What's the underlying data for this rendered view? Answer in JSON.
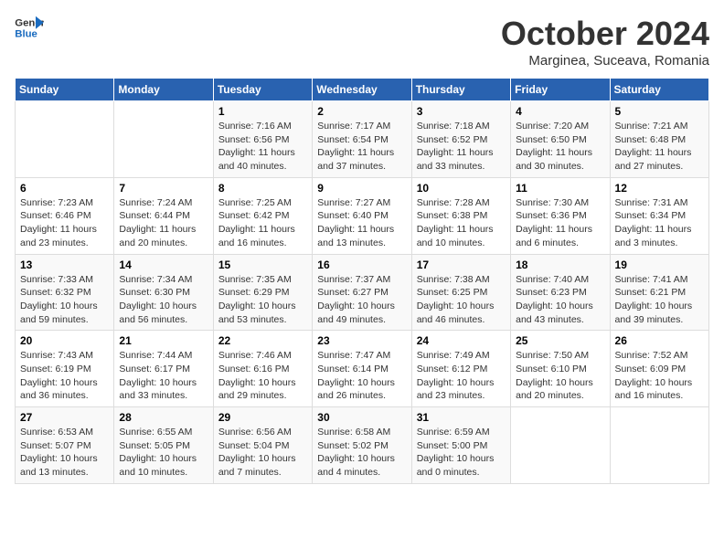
{
  "logo": {
    "line1": "General",
    "line2": "Blue"
  },
  "title": "October 2024",
  "location": "Marginea, Suceava, Romania",
  "days_of_week": [
    "Sunday",
    "Monday",
    "Tuesday",
    "Wednesday",
    "Thursday",
    "Friday",
    "Saturday"
  ],
  "weeks": [
    [
      {
        "day": "",
        "info": ""
      },
      {
        "day": "",
        "info": ""
      },
      {
        "day": "1",
        "info": "Sunrise: 7:16 AM\nSunset: 6:56 PM\nDaylight: 11 hours and 40 minutes."
      },
      {
        "day": "2",
        "info": "Sunrise: 7:17 AM\nSunset: 6:54 PM\nDaylight: 11 hours and 37 minutes."
      },
      {
        "day": "3",
        "info": "Sunrise: 7:18 AM\nSunset: 6:52 PM\nDaylight: 11 hours and 33 minutes."
      },
      {
        "day": "4",
        "info": "Sunrise: 7:20 AM\nSunset: 6:50 PM\nDaylight: 11 hours and 30 minutes."
      },
      {
        "day": "5",
        "info": "Sunrise: 7:21 AM\nSunset: 6:48 PM\nDaylight: 11 hours and 27 minutes."
      }
    ],
    [
      {
        "day": "6",
        "info": "Sunrise: 7:23 AM\nSunset: 6:46 PM\nDaylight: 11 hours and 23 minutes."
      },
      {
        "day": "7",
        "info": "Sunrise: 7:24 AM\nSunset: 6:44 PM\nDaylight: 11 hours and 20 minutes."
      },
      {
        "day": "8",
        "info": "Sunrise: 7:25 AM\nSunset: 6:42 PM\nDaylight: 11 hours and 16 minutes."
      },
      {
        "day": "9",
        "info": "Sunrise: 7:27 AM\nSunset: 6:40 PM\nDaylight: 11 hours and 13 minutes."
      },
      {
        "day": "10",
        "info": "Sunrise: 7:28 AM\nSunset: 6:38 PM\nDaylight: 11 hours and 10 minutes."
      },
      {
        "day": "11",
        "info": "Sunrise: 7:30 AM\nSunset: 6:36 PM\nDaylight: 11 hours and 6 minutes."
      },
      {
        "day": "12",
        "info": "Sunrise: 7:31 AM\nSunset: 6:34 PM\nDaylight: 11 hours and 3 minutes."
      }
    ],
    [
      {
        "day": "13",
        "info": "Sunrise: 7:33 AM\nSunset: 6:32 PM\nDaylight: 10 hours and 59 minutes."
      },
      {
        "day": "14",
        "info": "Sunrise: 7:34 AM\nSunset: 6:30 PM\nDaylight: 10 hours and 56 minutes."
      },
      {
        "day": "15",
        "info": "Sunrise: 7:35 AM\nSunset: 6:29 PM\nDaylight: 10 hours and 53 minutes."
      },
      {
        "day": "16",
        "info": "Sunrise: 7:37 AM\nSunset: 6:27 PM\nDaylight: 10 hours and 49 minutes."
      },
      {
        "day": "17",
        "info": "Sunrise: 7:38 AM\nSunset: 6:25 PM\nDaylight: 10 hours and 46 minutes."
      },
      {
        "day": "18",
        "info": "Sunrise: 7:40 AM\nSunset: 6:23 PM\nDaylight: 10 hours and 43 minutes."
      },
      {
        "day": "19",
        "info": "Sunrise: 7:41 AM\nSunset: 6:21 PM\nDaylight: 10 hours and 39 minutes."
      }
    ],
    [
      {
        "day": "20",
        "info": "Sunrise: 7:43 AM\nSunset: 6:19 PM\nDaylight: 10 hours and 36 minutes."
      },
      {
        "day": "21",
        "info": "Sunrise: 7:44 AM\nSunset: 6:17 PM\nDaylight: 10 hours and 33 minutes."
      },
      {
        "day": "22",
        "info": "Sunrise: 7:46 AM\nSunset: 6:16 PM\nDaylight: 10 hours and 29 minutes."
      },
      {
        "day": "23",
        "info": "Sunrise: 7:47 AM\nSunset: 6:14 PM\nDaylight: 10 hours and 26 minutes."
      },
      {
        "day": "24",
        "info": "Sunrise: 7:49 AM\nSunset: 6:12 PM\nDaylight: 10 hours and 23 minutes."
      },
      {
        "day": "25",
        "info": "Sunrise: 7:50 AM\nSunset: 6:10 PM\nDaylight: 10 hours and 20 minutes."
      },
      {
        "day": "26",
        "info": "Sunrise: 7:52 AM\nSunset: 6:09 PM\nDaylight: 10 hours and 16 minutes."
      }
    ],
    [
      {
        "day": "27",
        "info": "Sunrise: 6:53 AM\nSunset: 5:07 PM\nDaylight: 10 hours and 13 minutes."
      },
      {
        "day": "28",
        "info": "Sunrise: 6:55 AM\nSunset: 5:05 PM\nDaylight: 10 hours and 10 minutes."
      },
      {
        "day": "29",
        "info": "Sunrise: 6:56 AM\nSunset: 5:04 PM\nDaylight: 10 hours and 7 minutes."
      },
      {
        "day": "30",
        "info": "Sunrise: 6:58 AM\nSunset: 5:02 PM\nDaylight: 10 hours and 4 minutes."
      },
      {
        "day": "31",
        "info": "Sunrise: 6:59 AM\nSunset: 5:00 PM\nDaylight: 10 hours and 0 minutes."
      },
      {
        "day": "",
        "info": ""
      },
      {
        "day": "",
        "info": ""
      }
    ]
  ]
}
